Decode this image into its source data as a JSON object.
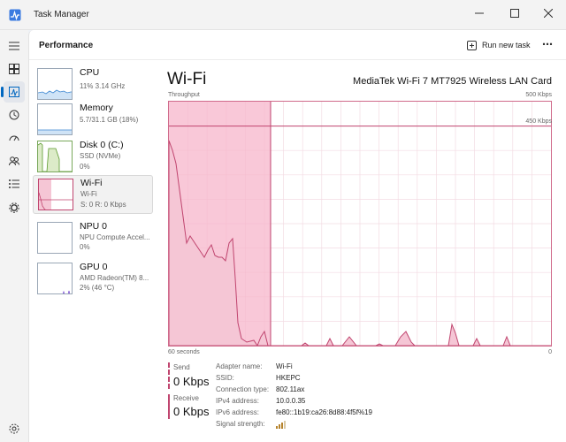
{
  "window": {
    "title": "Task Manager"
  },
  "header": {
    "title": "Performance",
    "run_task_label": "Run new task"
  },
  "nav_icons": [
    "hamburger-icon",
    "processes-icon",
    "performance-icon",
    "app-history-icon",
    "startup-apps-icon",
    "users-icon",
    "details-icon",
    "services-icon",
    "settings-icon"
  ],
  "tiles": [
    {
      "name": "CPU",
      "sub1": "11%  3.14 GHz",
      "sub2": ""
    },
    {
      "name": "Memory",
      "sub1": "5.7/31.1 GB (18%)",
      "sub2": ""
    },
    {
      "name": "Disk 0 (C:)",
      "sub1": "SSD (NVMe)",
      "sub2": "0%"
    },
    {
      "name": "Wi-Fi",
      "sub1": "Wi-Fi",
      "sub2": "S: 0 R: 0 Kbps"
    },
    {
      "name": "NPU 0",
      "sub1": "NPU Compute Accel...",
      "sub2": "0%"
    },
    {
      "name": "GPU 0",
      "sub1": "AMD Radeon(TM) 8...",
      "sub2": "2% (46 °C)"
    }
  ],
  "detail": {
    "title": "Wi-Fi",
    "adapter": "MediaTek Wi-Fi 7 MT7925 Wireless LAN Card",
    "throughput_label": "Throughput",
    "max_label": "500 Kbps",
    "line_label": "450 Kbps",
    "time_label": "60 seconds",
    "zero_label": "0"
  },
  "stats": {
    "send_label": "Send",
    "send_value": "0 Kbps",
    "receive_label": "Receive",
    "receive_value": "0 Kbps"
  },
  "info": [
    {
      "key": "Adapter name:",
      "value": "Wi-Fi"
    },
    {
      "key": "SSID:",
      "value": "HKEPC"
    },
    {
      "key": "Connection type:",
      "value": "802.11ax"
    },
    {
      "key": "IPv4 address:",
      "value": "10.0.0.35"
    },
    {
      "key": "IPv6 address:",
      "value": "fe80::1b19:ca26:8d88:4f5f%19"
    },
    {
      "key": "Signal strength:",
      "value": ""
    }
  ],
  "colors": {
    "accent": "#c0456f",
    "fill": "#f5c6d5",
    "highlight": "#f7b6cb"
  }
}
